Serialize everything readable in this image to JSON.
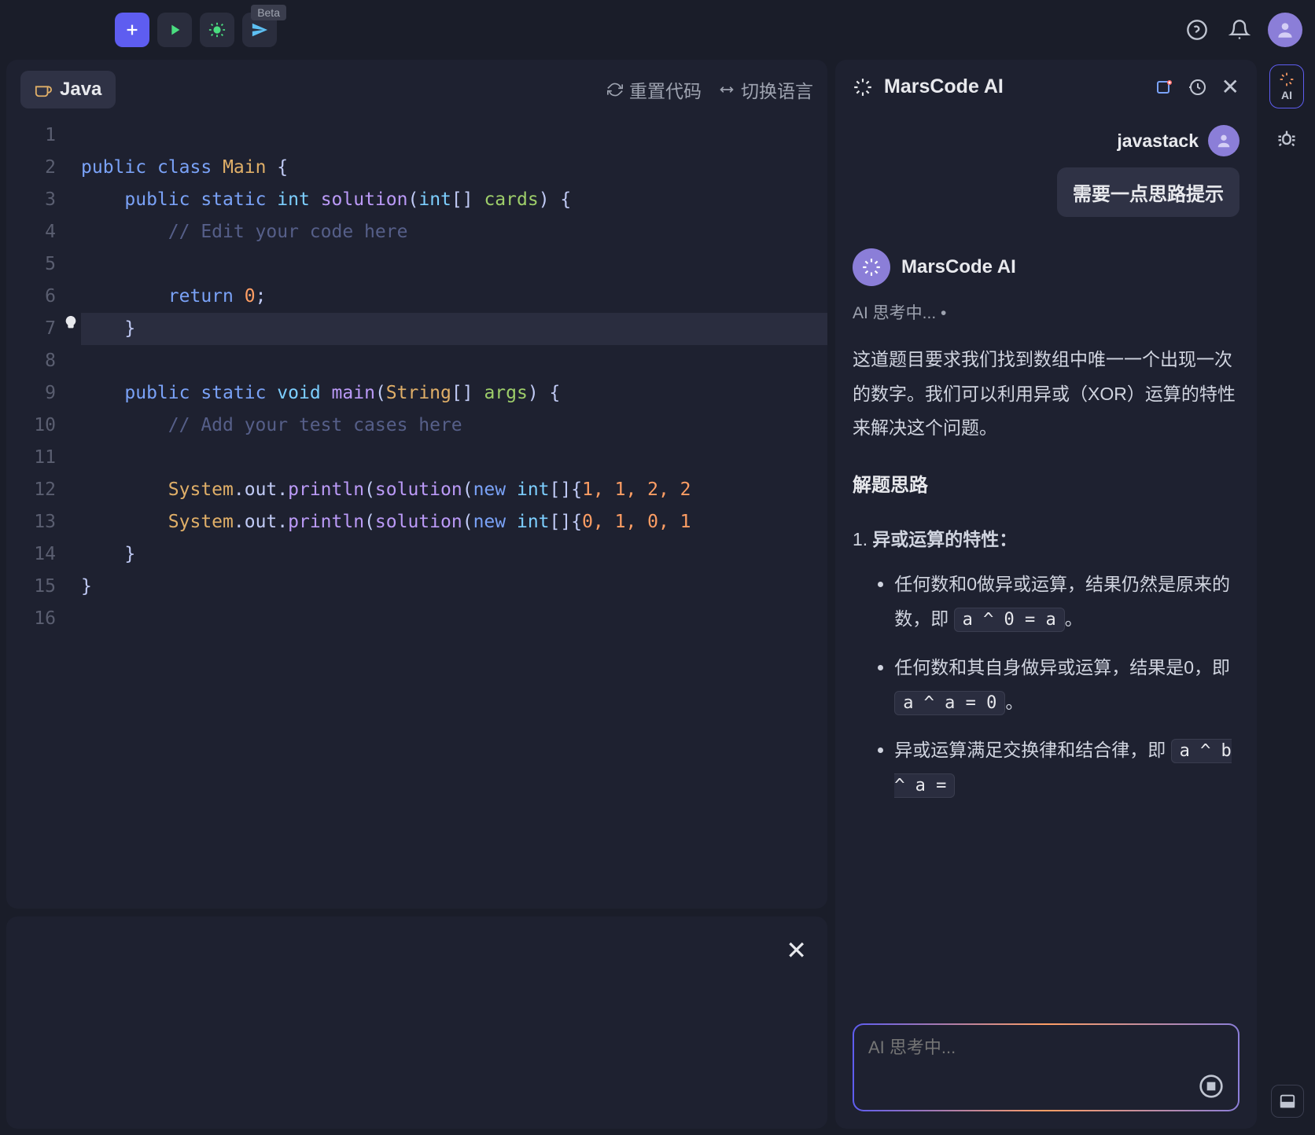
{
  "topbar": {
    "beta_badge": "Beta"
  },
  "editor": {
    "language": "Java",
    "actions": {
      "reset": "重置代码",
      "switch": "切换语言"
    },
    "line_numbers": [
      "1",
      "2",
      "3",
      "4",
      "5",
      "6",
      "7",
      "8",
      "9",
      "10",
      "11",
      "12",
      "13",
      "14",
      "15",
      "16"
    ],
    "code": {
      "l2": {
        "kw1": "public",
        "kw2": "class",
        "cls": "Main",
        "br": " {"
      },
      "l3": {
        "kw1": "public",
        "kw2": "static",
        "type": "int",
        "fn": "solution",
        "p1": "(",
        "type2": "int",
        "arr": "[] ",
        "arg": "cards",
        "p2": ") {"
      },
      "l4": {
        "cmt": "// Edit your code here"
      },
      "l6": {
        "kw": "return",
        "num": "0",
        "end": ";"
      },
      "l7": {
        "br": "}"
      },
      "l9": {
        "kw1": "public",
        "kw2": "static",
        "type": "void",
        "fn": "main",
        "p1": "(",
        "cls": "String",
        "arr": "[] ",
        "arg": "args",
        "p2": ") {"
      },
      "l10": {
        "cmt": "// Add your test cases here"
      },
      "l12": {
        "a": "System",
        "b": ".out.",
        "fn": "println",
        "p1": "(",
        "fn2": "solution",
        "p2": "(",
        "kw": "new",
        "type": "int",
        "arr": "[]{",
        "nums": "1, 1, 2, 2",
        "trail": ""
      },
      "l13": {
        "a": "System",
        "b": ".out.",
        "fn": "println",
        "p1": "(",
        "fn2": "solution",
        "p2": "(",
        "kw": "new",
        "type": "int",
        "arr": "[]{",
        "nums": "0, 1, 0, 1",
        "trail": ""
      },
      "l14": {
        "br": "}"
      },
      "l15": {
        "br": "}"
      }
    }
  },
  "ai": {
    "title": "MarsCode AI",
    "user_name": "javastack",
    "user_message": "需要一点思路提示",
    "assistant_name": "MarsCode AI",
    "thinking": "AI 思考中... •",
    "paragraph": "这道题目要求我们找到数组中唯一一个出现一次的数字。我们可以利用异或（XOR）运算的特性来解决这个问题。",
    "section_heading": "解题思路",
    "list_num": "1.",
    "list_title": "异或运算的特性：",
    "bullets": {
      "b1_pre": "任何数和0做异或运算，结果仍然是原来的数，即 ",
      "b1_code": "a ^ 0 = a",
      "b1_post": "。",
      "b2_pre": "任何数和其自身做异或运算，结果是0，即 ",
      "b2_code": "a ^ a = 0",
      "b2_post": "。",
      "b3_pre": "异或运算满足交换律和结合律，即 ",
      "b3_code": "a ^ b ^ a ="
    },
    "input_placeholder": "AI 思考中..."
  },
  "rail": {
    "ai_label": "AI"
  }
}
